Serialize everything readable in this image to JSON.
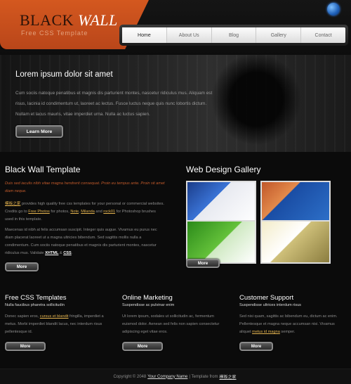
{
  "header": {
    "logo_main": "BLACK",
    "logo_accent": "WALL",
    "logo_sub": "Free CSS Template"
  },
  "nav": {
    "items": [
      "Home",
      "About Us",
      "Blog",
      "Gallery",
      "Contact"
    ]
  },
  "hero": {
    "title": "Lorem ipsum dolor sit amet",
    "text": "Cum sociis natoque penatibus et magnis dis parturient montes, nascetur ridiculus mus. Aliquam est risus, lacinia id condimentum ut, laoreet ac lectus. Fusce luctus neque quis nunc lobortis dictum. Nullam et lacus mauris, vitae imperdiet urna. Nulla ac luctus sapien.",
    "button": "Learn More"
  },
  "black_wall": {
    "title": "Black Wall Template",
    "intro": "Duis sed iaculis nibh vitae magna hendrerit consequat. Proin eu tempus ante. Proin sit amet diam neque.",
    "p1_link1": "模板之家",
    "p1_text1": " provides high quality free css templates for your personal or commercial websites. Credits go to ",
    "p1_link2": "Free Photos",
    "p1_text2": " for photos, ",
    "p1_link3": "Note",
    "p1_text3": ", ",
    "p1_link4": "Milanda",
    "p1_text4": " and ",
    "p1_link5": "rock01",
    "p1_text5": " for Photoshop brushes used in this template.",
    "p2": "Maecenas id nibh at felis accumsan suscipit. Integer quis augue. Vivamus eu purus nec diam placerat laoreet ut a magna ultricies bibendum. Sed sagittis mollis nulla a condimentum. Cum sociis natoque penatibus et magnis dis parturient montes, nascetur ridiculus mus. Validate ",
    "p2_link1": "XHTML",
    "p2_mid": " & ",
    "p2_link2": "CSS",
    "p2_end": ".",
    "button": "More"
  },
  "gallery": {
    "title": "Web Design Gallery",
    "button": "More"
  },
  "bottom": [
    {
      "title": "Free CSS Templates",
      "subtitle": "Nulla faucibus pharetra sollicitudin",
      "text_a": "Donec sapien eros, ",
      "link": "cursus et blandit",
      "text_b": " fringilla, imperdiet a metus. Morbi imperdiet blandit lacus, nec interdum risus pellentesque id.",
      "button": "More"
    },
    {
      "title": "Online Marketing",
      "subtitle": "Suspendisse ac pulvinar enim",
      "text_a": "Ut lorem ipsum, sodales ut sollicitudin ac, fermentum euismod dolor. Aenean sed felis non sapien consectetur adipiscing eget vitae eros.",
      "link": "",
      "text_b": "",
      "button": "More"
    },
    {
      "title": "Customer Support",
      "subtitle": "Suspendisse ultrices interdum risus",
      "text_a": "Sed nisi quam, sagittis ac bibendum eu, dictum ac enim. Pellentesque et magna neque accumsan nisi. Vivamus aliquet ",
      "link": "metus id magna",
      "text_b": " semper.",
      "button": "More"
    }
  ],
  "footer": {
    "prefix": "Copyright © 2048 ",
    "company": "Your Company Name",
    "sep": " | Template from ",
    "source": "模板之家"
  }
}
